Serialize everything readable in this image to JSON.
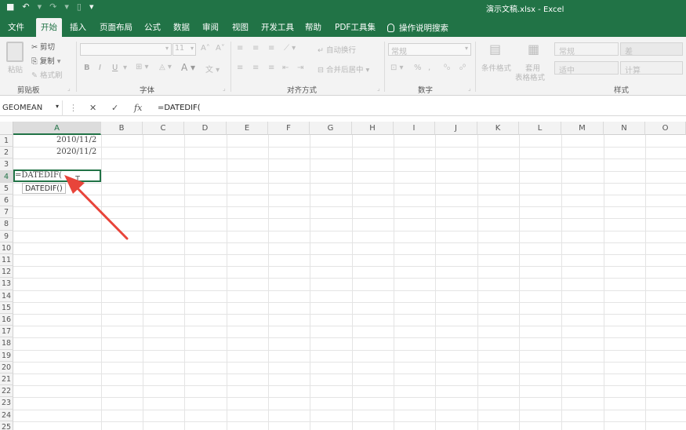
{
  "titlebar": {
    "title": "演示文稿.xlsx  -  Excel",
    "qat": {
      "save": "💾",
      "undo": "↶",
      "redo": "↷",
      "more": "▾"
    }
  },
  "tabs": [
    "文件",
    "开始",
    "插入",
    "页面布局",
    "公式",
    "数据",
    "审阅",
    "视图",
    "开发工具",
    "帮助",
    "PDF工具集"
  ],
  "active_tab": "开始",
  "tellme": "操作说明搜索",
  "ribbon": {
    "clipboard": {
      "paste": "粘贴",
      "cut": "剪切",
      "copy": "复制",
      "format_painter": "格式刷",
      "label": "剪贴板"
    },
    "font": {
      "size": "11",
      "label": "字体",
      "bold": "B",
      "italic": "I",
      "underline": "U"
    },
    "alignment": {
      "wrap": "自动换行",
      "merge": "合并后居中",
      "label": "对齐方式"
    },
    "number": {
      "format": "常规",
      "percent": "%",
      "label": "数字"
    },
    "styles": {
      "conditional": "条件格式",
      "table_format_1": "套用",
      "table_format_2": "表格格式",
      "gallery": [
        "常规",
        "差",
        "适中",
        "计算"
      ],
      "label": "样式"
    }
  },
  "formula_bar": {
    "name_box": "GEOMEAN",
    "cancel": "✕",
    "enter": "✓",
    "fx": "fx",
    "formula": "=DATEDIF("
  },
  "grid": {
    "columns": [
      "A",
      "B",
      "C",
      "D",
      "E",
      "F",
      "G",
      "H",
      "I",
      "J",
      "K",
      "L",
      "M",
      "N",
      "O"
    ],
    "rows": [
      "1",
      "2",
      "3",
      "4",
      "5",
      "6",
      "7",
      "8",
      "9",
      "10",
      "11",
      "12",
      "13",
      "14",
      "15",
      "16",
      "17",
      "18",
      "19",
      "20",
      "21",
      "22",
      "23",
      "24",
      "25"
    ],
    "cells": {
      "A1": "2010/11/2",
      "A2": "2020/11/2",
      "A4": "=DATEDIF("
    },
    "tooltip": "DATEDIF()",
    "selected_column": "A",
    "selected_row": "4"
  },
  "colors": {
    "accent": "#217346",
    "arrow": "#e8443a"
  }
}
